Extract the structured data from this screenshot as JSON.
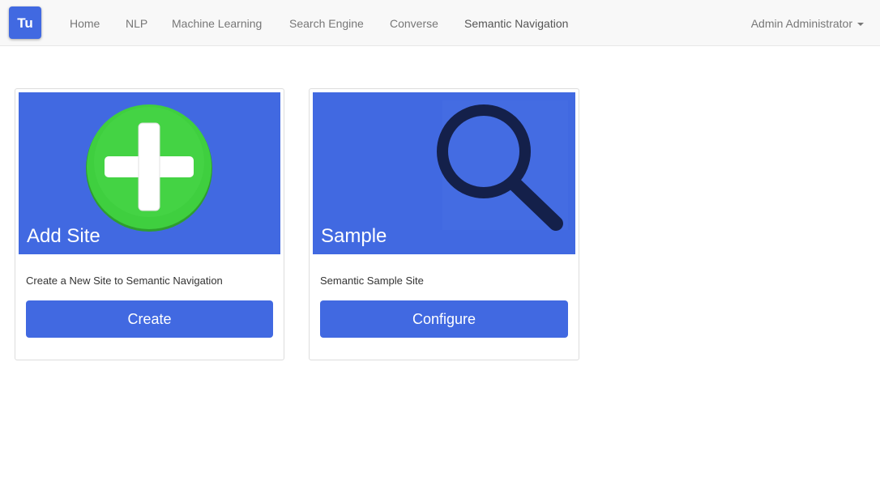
{
  "navbar": {
    "brand": "Tu",
    "items": [
      {
        "label": "Home"
      },
      {
        "label": "NLP"
      },
      {
        "label": "Machine Learning"
      },
      {
        "label": "Search Engine"
      },
      {
        "label": "Converse"
      },
      {
        "label": "Semantic Navigation",
        "active": true
      }
    ],
    "user": "Admin Administrator"
  },
  "cards": [
    {
      "title": "Add Site",
      "description": "Create a New Site to Semantic Navigation",
      "button": "Create",
      "icon": "plus-circle-icon"
    },
    {
      "title": "Sample",
      "description": "Semantic Sample Site",
      "button": "Configure",
      "icon": "magnifier-icon"
    }
  ],
  "colors": {
    "accent": "#4169e1",
    "plus_green": "#3fcf3f",
    "magnifier": "#14204a"
  }
}
